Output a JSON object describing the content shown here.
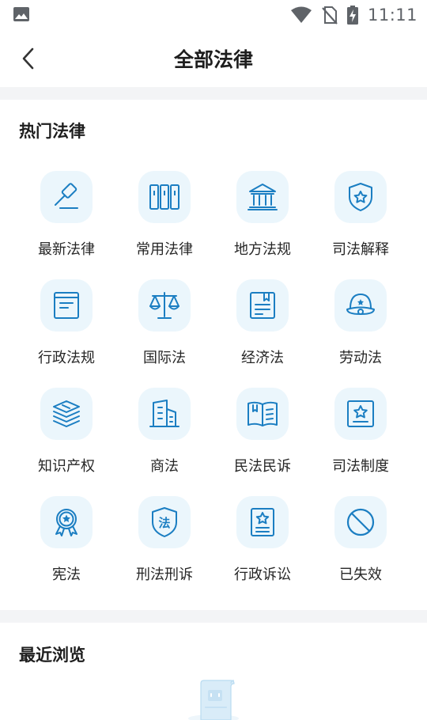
{
  "status_bar": {
    "time": "11:11",
    "icons": [
      "photo-icon",
      "wifi-icon",
      "no-sim-icon",
      "battery-charging-icon"
    ]
  },
  "nav": {
    "title": "全部法律",
    "back_icon": "chevron-left-icon"
  },
  "hot_laws": {
    "title": "热门法律",
    "items": [
      {
        "label": "最新法律",
        "icon": "gavel-icon"
      },
      {
        "label": "常用法律",
        "icon": "books-icon"
      },
      {
        "label": "地方法规",
        "icon": "courthouse-icon"
      },
      {
        "label": "司法解释",
        "icon": "shield-star-icon"
      },
      {
        "label": "行政法规",
        "icon": "folder-document-icon"
      },
      {
        "label": "国际法",
        "icon": "scales-icon"
      },
      {
        "label": "经济法",
        "icon": "bookmarked-document-icon"
      },
      {
        "label": "劳动法",
        "icon": "police-cap-icon"
      },
      {
        "label": "知识产权",
        "icon": "stacked-books-icon"
      },
      {
        "label": "商法",
        "icon": "buildings-icon"
      },
      {
        "label": "民法民诉",
        "icon": "open-book-icon"
      },
      {
        "label": "司法制度",
        "icon": "star-frame-icon"
      },
      {
        "label": "宪法",
        "icon": "rosette-star-icon"
      },
      {
        "label": "刑法刑诉",
        "icon": "law-shield-icon"
      },
      {
        "label": "行政诉讼",
        "icon": "star-document-icon"
      },
      {
        "label": "已失效",
        "icon": "prohibited-icon"
      }
    ]
  },
  "recent": {
    "title": "最近浏览",
    "empty_icon": "empty-document-icon"
  },
  "colors": {
    "accent": "#1b7ec2",
    "tile_bg": "#ebf6fc",
    "divider": "#f3f4f6"
  }
}
